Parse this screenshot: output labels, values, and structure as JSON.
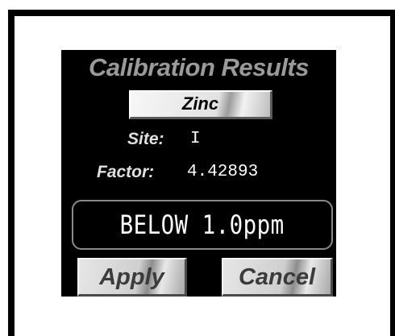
{
  "screen": {
    "title": "Calibration Results",
    "element_label": "Zinc",
    "site": {
      "label": "Site:",
      "value": "I"
    },
    "factor": {
      "label": "Factor:",
      "value": "4.42893"
    },
    "result_text": "BELOW 1.0ppm",
    "buttons": {
      "apply": "Apply",
      "cancel": "Cancel"
    }
  },
  "colors": {
    "screen_background": "#000000",
    "title_text": "#9a9a9a",
    "button_face": "#d8d8d8"
  }
}
